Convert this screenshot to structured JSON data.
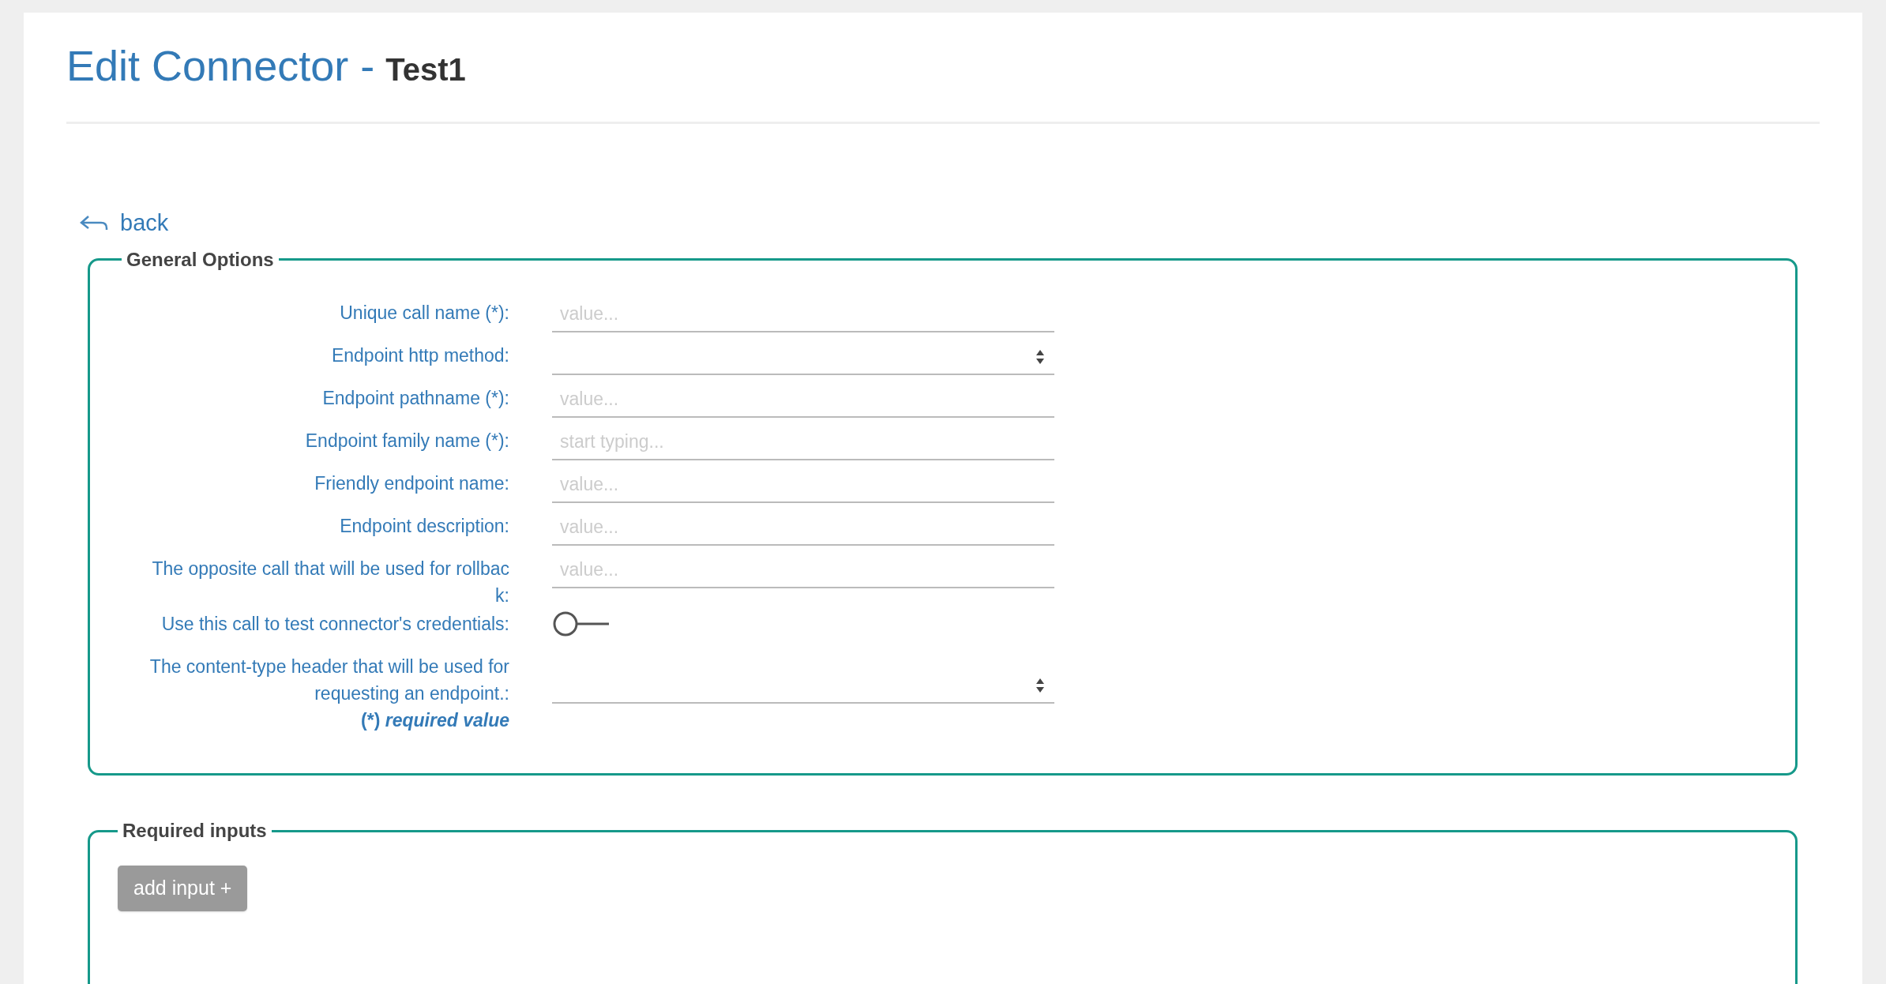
{
  "page": {
    "title": "Edit Connector -",
    "subtitle": "Test1"
  },
  "back_link": {
    "label": "back"
  },
  "general_options": {
    "legend": "General Options",
    "fields": [
      {
        "kind": "text",
        "label": "Unique call name (*):",
        "placeholder": "value..."
      },
      {
        "kind": "select",
        "label": "Endpoint http method:"
      },
      {
        "kind": "text",
        "label": "Endpoint pathname (*):",
        "placeholder": "value..."
      },
      {
        "kind": "text",
        "label": "Endpoint family name (*):",
        "placeholder": "start typing..."
      },
      {
        "kind": "text",
        "label": "Friendly endpoint name:",
        "placeholder": "value..."
      },
      {
        "kind": "text",
        "label": "Endpoint description:",
        "placeholder": "value..."
      },
      {
        "kind": "text",
        "label": "The opposite call that will be used for rollback:",
        "placeholder": "value..."
      },
      {
        "kind": "toggle",
        "label": "Use this call to test connector's credentials:",
        "on": false
      },
      {
        "kind": "select",
        "label": "The content-type header that will be used for requesting an endpoint.:"
      }
    ],
    "required_note": "(*) *required value*"
  },
  "required_inputs": {
    "legend": "Required inputs",
    "add_button": "add input +"
  }
}
